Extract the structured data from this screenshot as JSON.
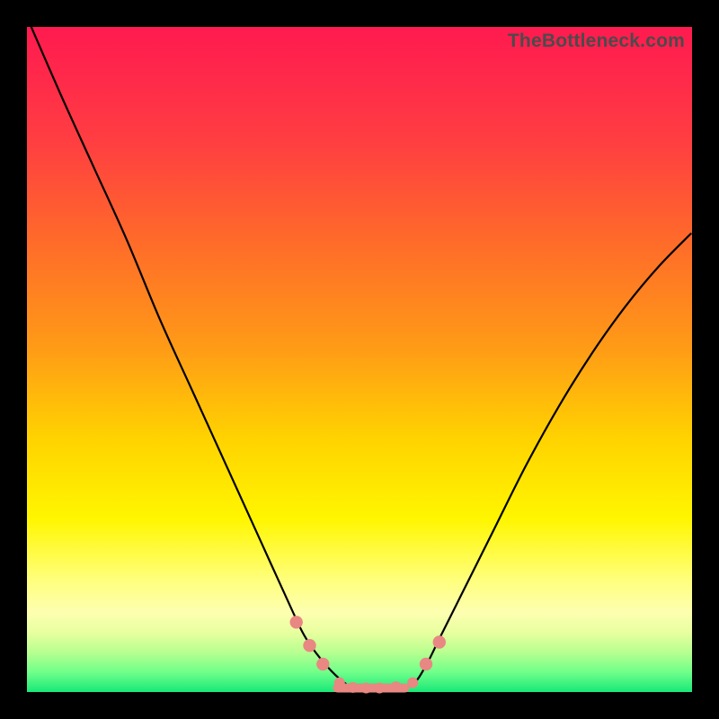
{
  "watermark": "TheBottleneck.com",
  "colors": {
    "frame": "#000000",
    "dot": "#e98782",
    "curve": "#000000",
    "gradient_top": "#ff1a4f",
    "gradient_bottom": "#18e878"
  },
  "chart_data": {
    "type": "line",
    "title": "",
    "xlabel": "",
    "ylabel": "",
    "xlim": [
      0,
      100
    ],
    "ylim": [
      0,
      100
    ],
    "x": [
      0,
      5,
      10,
      15,
      20,
      25,
      30,
      35,
      40,
      42,
      45,
      48,
      50,
      52,
      55,
      58,
      60,
      62,
      65,
      70,
      75,
      80,
      85,
      90,
      95,
      99.9
    ],
    "values": [
      101.5,
      90,
      79,
      68,
      56,
      45,
      34,
      23,
      12,
      8,
      4,
      1.2,
      0.5,
      0.5,
      0.6,
      1.2,
      4,
      8,
      14,
      24,
      34,
      43,
      51,
      58,
      64,
      69
    ],
    "markers_x": [
      40.5,
      42.5,
      44.5,
      47,
      49,
      51,
      53,
      55.5,
      58,
      60,
      62
    ],
    "markers_y": [
      10.5,
      7,
      4.2,
      1.4,
      0.7,
      0.6,
      0.6,
      0.8,
      1.4,
      4.2,
      7.5
    ],
    "flat_bottom": {
      "x0": 46,
      "x1": 57.5,
      "y": 0.6
    }
  }
}
